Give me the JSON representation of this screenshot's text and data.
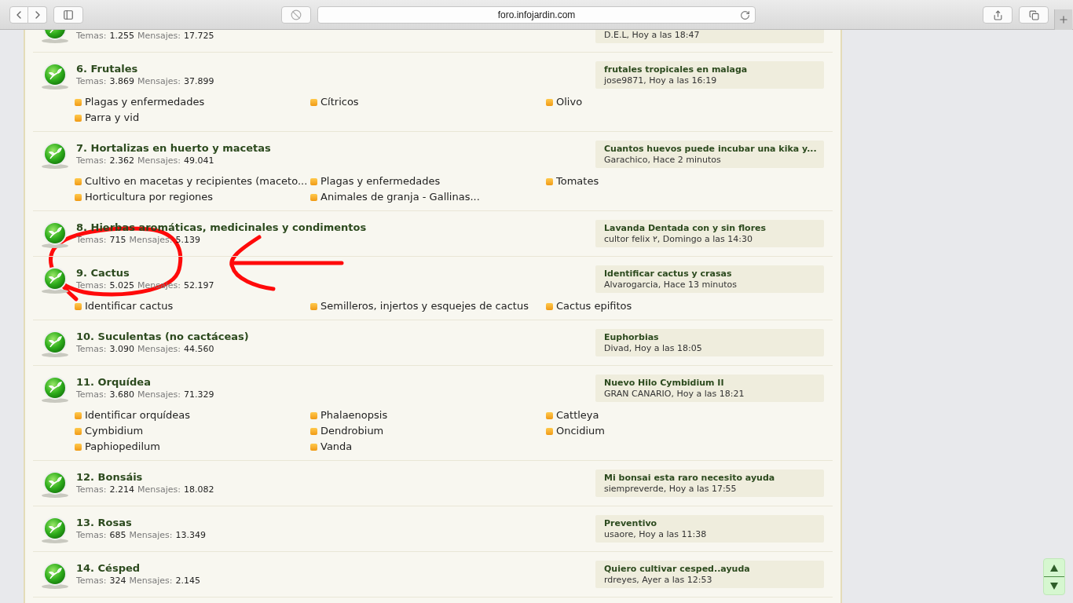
{
  "browser": {
    "url": "foro.infojardin.com"
  },
  "forums": [
    {
      "stats": {
        "temas_label": "Temas:",
        "temas": "1.255",
        "mensajes_label": "Mensajes:",
        "mensajes": "17.725"
      },
      "last_post": {
        "meta": "D.E.L, Hoy a las 18:47"
      }
    },
    {
      "title": "6. Frutales",
      "stats": {
        "temas_label": "Temas:",
        "temas": "3.869",
        "mensajes_label": "Mensajes:",
        "mensajes": "37.899"
      },
      "subforums": [
        "Plagas y enfermedades",
        "Cítricos",
        "Olivo",
        "Parra y vid"
      ],
      "last_post": {
        "title": "frutales tropicales en malaga",
        "meta": "jose9871, Hoy a las 16:19"
      }
    },
    {
      "title": "7. Hortalizas en huerto y macetas",
      "stats": {
        "temas_label": "Temas:",
        "temas": "2.362",
        "mensajes_label": "Mensajes:",
        "mensajes": "49.041"
      },
      "subforums": [
        "Cultivo en macetas y recipientes (maceto...",
        "Plagas y enfermedades",
        "Tomates",
        "Horticultura por regiones",
        "Animales de granja - Gallinas..."
      ],
      "last_post": {
        "title": "Cuantos huevos puede incubar una kika y...",
        "meta": "Garachico, Hace 2 minutos"
      }
    },
    {
      "title": "8. Hierbas aromáticas, medicinales y condimentos",
      "stats": {
        "temas_label": "Temas:",
        "temas": "715",
        "mensajes_label": "Mensajes:",
        "mensajes": "5.139"
      },
      "last_post": {
        "title": "Lavanda Dentada con y sin flores",
        "meta": "cultor felix ٢, Domingo a las 14:30"
      }
    },
    {
      "title": "9. Cactus",
      "stats": {
        "temas_label": "Temas:",
        "temas": "5.025",
        "mensajes_label": "Mensajes:",
        "mensajes": "52.197"
      },
      "subforums": [
        "Identificar cactus",
        "Semilleros, injertos y esquejes de cactus",
        "Cactus epifitos"
      ],
      "last_post": {
        "title": "Identificar cactus y crasas",
        "meta": "Alvarogarcia, Hace 13 minutos"
      }
    },
    {
      "title": "10. Suculentas (no cactáceas)",
      "stats": {
        "temas_label": "Temas:",
        "temas": "3.090",
        "mensajes_label": "Mensajes:",
        "mensajes": "44.560"
      },
      "last_post": {
        "title": "Euphorbias",
        "meta": "Divad, Hoy a las 18:05"
      }
    },
    {
      "title": "11. Orquídea",
      "stats": {
        "temas_label": "Temas:",
        "temas": "3.680",
        "mensajes_label": "Mensajes:",
        "mensajes": "71.329"
      },
      "subforums": [
        "Identificar orquídeas",
        "Phalaenopsis",
        "Cattleya",
        "Cymbidium",
        "Dendrobium",
        "Oncidium",
        "Paphiopedilum",
        "Vanda"
      ],
      "last_post": {
        "title": "Nuevo Hilo Cymbidium II",
        "meta": "GRAN CANARIO, Hoy a las 18:21"
      }
    },
    {
      "title": "12. Bonsáis",
      "stats": {
        "temas_label": "Temas:",
        "temas": "2.214",
        "mensajes_label": "Mensajes:",
        "mensajes": "18.082"
      },
      "last_post": {
        "title": "Mi bonsai esta raro necesito ayuda",
        "meta": "siempreverde, Hoy a las 17:55"
      }
    },
    {
      "title": "13. Rosas",
      "stats": {
        "temas_label": "Temas:",
        "temas": "685",
        "mensajes_label": "Mensajes:",
        "mensajes": "13.349"
      },
      "last_post": {
        "title": "Preventivo",
        "meta": "usaore, Hoy a las 11:38"
      }
    },
    {
      "title": "14. Césped",
      "stats": {
        "temas_label": "Temas:",
        "temas": "324",
        "mensajes_label": "Mensajes:",
        "mensajes": "2.145"
      },
      "last_post": {
        "title": "Quiero cultivar cesped..ayuda",
        "meta": "rdreyes, Ayer a las 12:53"
      }
    }
  ]
}
